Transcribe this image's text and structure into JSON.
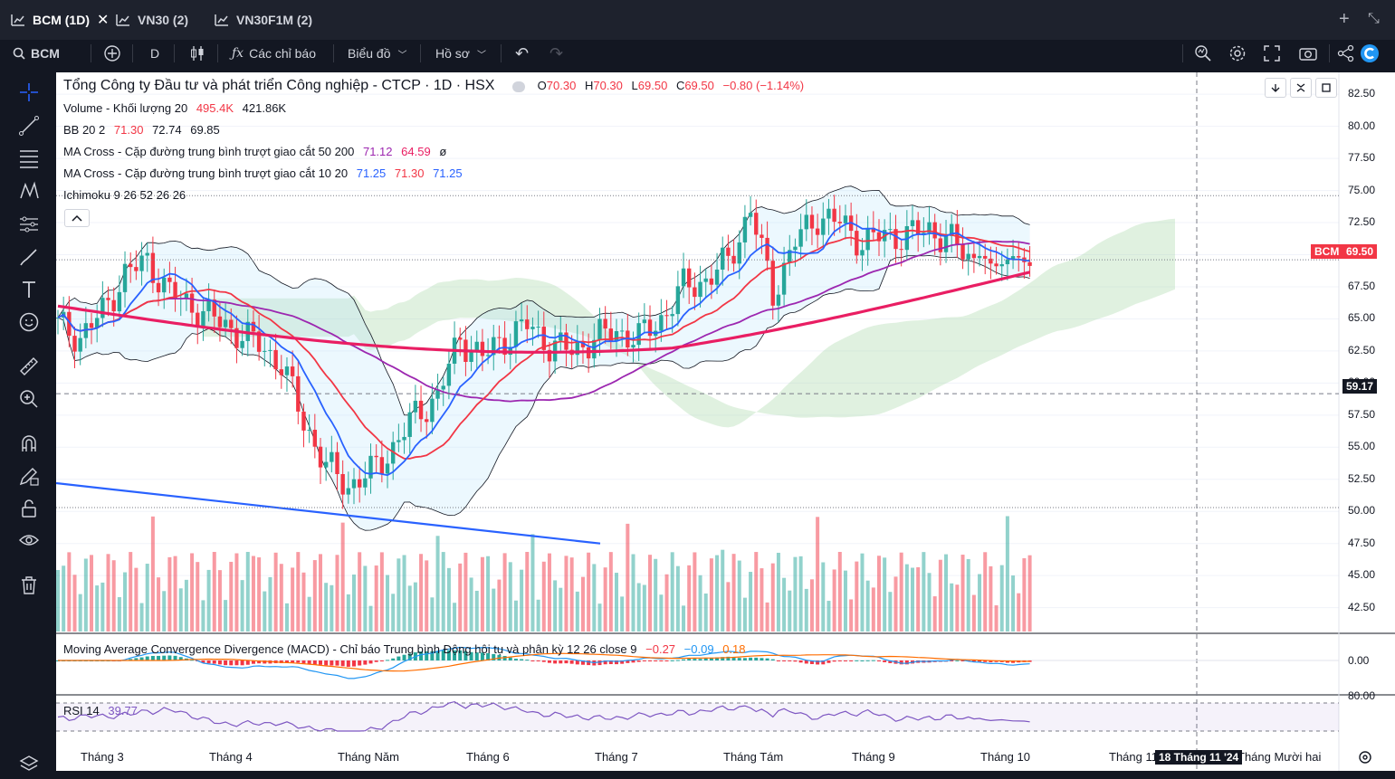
{
  "tabs": [
    {
      "label": "BCM (1D)",
      "active": true
    },
    {
      "label": "VN30 (2)",
      "active": false
    },
    {
      "label": "VN30F1M (2)",
      "active": false
    }
  ],
  "toolbar": {
    "symbol": "BCM",
    "interval": "D",
    "indicators_label": "Các chỉ báo",
    "chart_type_label": "Biểu đồ",
    "profile_label": "Hồ sơ"
  },
  "legend": {
    "title": "Tổng Công ty Đầu tư và phát triển Công nghiệp - CTCP · 1D · HSX",
    "o_label": "O",
    "o": "70.30",
    "h_label": "H",
    "h": "70.30",
    "l_label": "L",
    "l": "69.50",
    "c_label": "C",
    "c": "69.50",
    "change": "−0.80 (−1.14%)",
    "volume_name": "Volume - Khối lượng 20",
    "volume_v1": "495.4K",
    "volume_v2": "421.86K",
    "bb_name": "BB 20 2",
    "bb_v1": "71.30",
    "bb_v2": "72.74",
    "bb_v3": "69.85",
    "ma1_name": "MA Cross - Cặp đường trung bình trượt giao cắt 50 200",
    "ma1_v1": "71.12",
    "ma1_v2": "64.59",
    "ma1_v3": "ø",
    "ma2_name": "MA Cross - Cặp đường trung bình trượt giao cắt 10 20",
    "ma2_v1": "71.25",
    "ma2_v2": "71.30",
    "ma2_v3": "71.25",
    "ichimoku_name": "Ichimoku 9 26 52 26 26",
    "macd_name": "Moving Average Convergence Divergence (MACD) - Chỉ báo Trung bình Động hội tụ và phân kỳ 12 26 close 9",
    "macd_v1": "−0.27",
    "macd_v2": "−0.09",
    "macd_v3": "0.18",
    "rsi_name": "RSI 14",
    "rsi_v": "39.77"
  },
  "price_tags": {
    "current_label": "BCM",
    "current": "69.50",
    "crosshair": "59.17"
  },
  "macd_axis": "0.00",
  "rsi_axis": "80.00",
  "crosshair_date": "18 Tháng 11 '24",
  "colors": {
    "up": "#26a69a",
    "down": "#f23645",
    "ma_fast": "#2962ff",
    "ma_slow": "#f23645",
    "ma50": "#9c27b0",
    "ma200": "#e91e63",
    "accent": "#2962ff"
  },
  "chart_data": {
    "type": "candlestick",
    "ylim": [
      40.5,
      83.5
    ],
    "y_ticks": [
      "82.50",
      "80.00",
      "77.50",
      "75.00",
      "72.50",
      "70.00",
      "67.50",
      "65.00",
      "62.50",
      "60.00",
      "57.50",
      "55.00",
      "52.50",
      "50.00",
      "47.50",
      "45.00",
      "42.50"
    ],
    "x_ticks": [
      "Tháng 3",
      "Tháng 4",
      "Tháng Năm",
      "Tháng 6",
      "Tháng 7",
      "Tháng Tám",
      "Tháng 9",
      "Tháng 10",
      "Tháng 11",
      "Tháng Mười hai"
    ],
    "x_tick_pos": [
      0,
      1,
      2,
      3,
      4,
      5,
      6,
      7,
      8,
      9
    ],
    "series_close": [
      {
        "i": 0,
        "v": 64.5
      },
      {
        "i": 4,
        "v": 63.6
      },
      {
        "i": 8,
        "v": 65.5
      },
      {
        "i": 12,
        "v": 68.5
      },
      {
        "i": 16,
        "v": 69.5
      },
      {
        "i": 20,
        "v": 67.0
      },
      {
        "i": 24,
        "v": 66.0
      },
      {
        "i": 28,
        "v": 65.0
      },
      {
        "i": 32,
        "v": 64.0
      },
      {
        "i": 36,
        "v": 63.0
      },
      {
        "i": 40,
        "v": 61.5
      },
      {
        "i": 44,
        "v": 57.0
      },
      {
        "i": 48,
        "v": 53.5
      },
      {
        "i": 52,
        "v": 52.0
      },
      {
        "i": 56,
        "v": 53.0
      },
      {
        "i": 60,
        "v": 55.0
      },
      {
        "i": 64,
        "v": 57.5
      },
      {
        "i": 68,
        "v": 59.0
      },
      {
        "i": 72,
        "v": 63.5
      },
      {
        "i": 76,
        "v": 62.0
      },
      {
        "i": 80,
        "v": 63.5
      },
      {
        "i": 84,
        "v": 64.5
      },
      {
        "i": 88,
        "v": 63.0
      },
      {
        "i": 92,
        "v": 62.5
      },
      {
        "i": 96,
        "v": 63.5
      },
      {
        "i": 100,
        "v": 64.0
      },
      {
        "i": 104,
        "v": 63.5
      },
      {
        "i": 108,
        "v": 65.0
      },
      {
        "i": 112,
        "v": 67.5
      },
      {
        "i": 116,
        "v": 68.0
      },
      {
        "i": 120,
        "v": 69.5
      },
      {
        "i": 124,
        "v": 73.5
      },
      {
        "i": 128,
        "v": 67.0
      },
      {
        "i": 132,
        "v": 71.0
      },
      {
        "i": 136,
        "v": 73.0
      },
      {
        "i": 140,
        "v": 72.5
      },
      {
        "i": 144,
        "v": 71.0
      },
      {
        "i": 148,
        "v": 71.5
      },
      {
        "i": 152,
        "v": 71.5
      },
      {
        "i": 156,
        "v": 72.0
      },
      {
        "i": 160,
        "v": 71.0
      },
      {
        "i": 164,
        "v": 69.5
      }
    ],
    "last_close": 69.5,
    "rsi_last": 39.77
  }
}
